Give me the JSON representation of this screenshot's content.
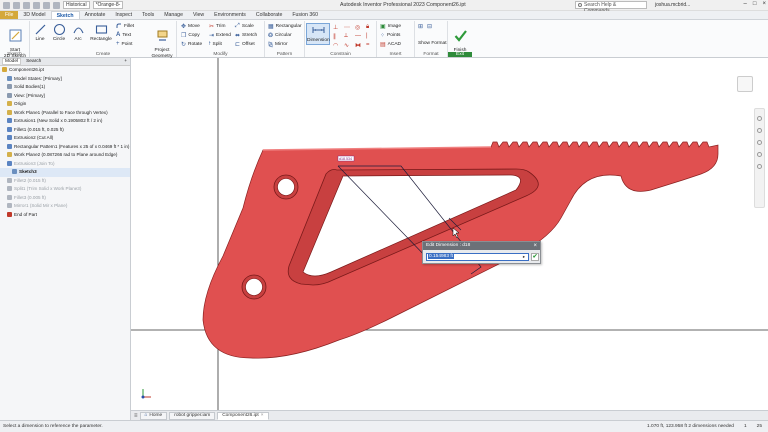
{
  "titlebar": {
    "appearance_combo": "Historical",
    "material_combo": "*Orange-8-",
    "title": "Autodesk Inventor Professional 2023    Component26.ipt",
    "search_placeholder": "Search Help & Commands...",
    "user": "joshua.mcbrid...",
    "controls": [
      "–",
      "□",
      "×"
    ]
  },
  "tabs": [
    "File",
    "3D Model",
    "Sketch",
    "Annotate",
    "Inspect",
    "Tools",
    "Manage",
    "View",
    "Environments",
    "Collaborate",
    "Fusion 360"
  ],
  "ribbon": {
    "sketch": {
      "start_2d": "Start\n2D Sketch",
      "label": "Sketch"
    },
    "create": {
      "line": "Line",
      "circle": "Circle",
      "arc": "Arc",
      "rectangle": "Rectangle",
      "fillet": "Fillet",
      "text": "Text",
      "point": "Point",
      "project_geometry": "Project\nGeometry",
      "label": "Create"
    },
    "modify": {
      "move": "Move",
      "copy": "Copy",
      "rotate": "Rotate",
      "trim": "Trim",
      "extend": "Extend",
      "split": "Split",
      "scale": "Scale",
      "stretch": "Stretch",
      "offset": "Offset",
      "label": "Modify"
    },
    "pattern": {
      "rectangular": "Rectangular",
      "circular": "Circular",
      "mirror": "Mirror",
      "label": "Pattern"
    },
    "constrain": {
      "dimension": "Dimension",
      "label": "Constrain"
    },
    "insert": {
      "image": "Image",
      "points": "Points",
      "acad": "ACAD",
      "label": "Insert"
    },
    "format": {
      "show_format": "Show Format",
      "label": "Format"
    },
    "exit": {
      "finish_sketch": "Finish\nSketch",
      "label": "Exit"
    }
  },
  "browser": {
    "tabs": [
      "Model",
      "Search"
    ],
    "items": [
      {
        "label": "Component26.ipt",
        "color": "#d4a83a",
        "indent": 0,
        "state": "normal"
      },
      {
        "label": "Model States: [Primary]",
        "color": "#6a8fbf",
        "indent": 1,
        "state": "normal"
      },
      {
        "label": "Solid Bodies(1)",
        "color": "#8a9ab0",
        "indent": 1,
        "state": "normal"
      },
      {
        "label": "View: [Primary]",
        "color": "#8a9ab0",
        "indent": 1,
        "state": "normal"
      },
      {
        "label": "Origin",
        "color": "#d4b04a",
        "indent": 1,
        "state": "normal"
      },
      {
        "label": "Work Plane1 (Parallel to Face through Vertex)",
        "color": "#d4b04a",
        "indent": 1,
        "state": "normal"
      },
      {
        "label": "Extrusion1 (New Solid x 0.1905802 ft / 2 in)",
        "color": "#5b84c2",
        "indent": 1,
        "state": "normal"
      },
      {
        "label": "Fillet1 (0.015 ft, 0.025 ft)",
        "color": "#5b84c2",
        "indent": 1,
        "state": "normal"
      },
      {
        "label": "Extrusion2 (Cut All)",
        "color": "#5b84c2",
        "indent": 1,
        "state": "normal"
      },
      {
        "label": "Rectangular Pattern1 (Features x 25 of x 0.0469 ft * 1 in)",
        "color": "#5b84c2",
        "indent": 1,
        "state": "normal"
      },
      {
        "label": "Work Plane2 (0.087266 rad to Plane around Edge)",
        "color": "#d4b04a",
        "indent": 1,
        "state": "normal"
      },
      {
        "label": "Extrusion3 (Join To)",
        "color": "#5b84c2",
        "indent": 1,
        "state": "dim"
      },
      {
        "label": "Sketch3",
        "color": "#6a8fbf",
        "indent": 2,
        "state": "sel"
      },
      {
        "label": "Fillet2 (0.015 ft)",
        "color": "#b0b6c0",
        "indent": 1,
        "state": "dim"
      },
      {
        "label": "Split1 (Trim Solid x Work Plane3)",
        "color": "#b0b6c0",
        "indent": 1,
        "state": "dim"
      },
      {
        "label": "Fillet3 (0.005 ft)",
        "color": "#b0b6c0",
        "indent": 1,
        "state": "dim"
      },
      {
        "label": "Mirror1 (Solid Mir x Plane)",
        "color": "#b0b6c0",
        "indent": 1,
        "state": "dim"
      },
      {
        "label": "End of Part",
        "color": "#c0392b",
        "indent": 1,
        "state": "normal"
      }
    ]
  },
  "canvas": {
    "part_color": "#e05050",
    "part_edge_color": "#8a2020",
    "dimension_tag": "d18.534"
  },
  "dim_dialog": {
    "title": "Edit Dimension : d18",
    "value": "0.154983 ft",
    "ok": "✔",
    "close": "×",
    "arrow": "▸"
  },
  "doctabs": [
    {
      "label": "Home",
      "active": false
    },
    {
      "label": "robot gripper.iam",
      "active": false
    },
    {
      "label": "Component26.ipt",
      "active": true
    }
  ],
  "statusbar": {
    "message": "Select a dimension to reference the parameter.",
    "coords": "1.070 ft, 123.958 ft   2 dimensions needed",
    "page": "1",
    "zoom": "25"
  }
}
